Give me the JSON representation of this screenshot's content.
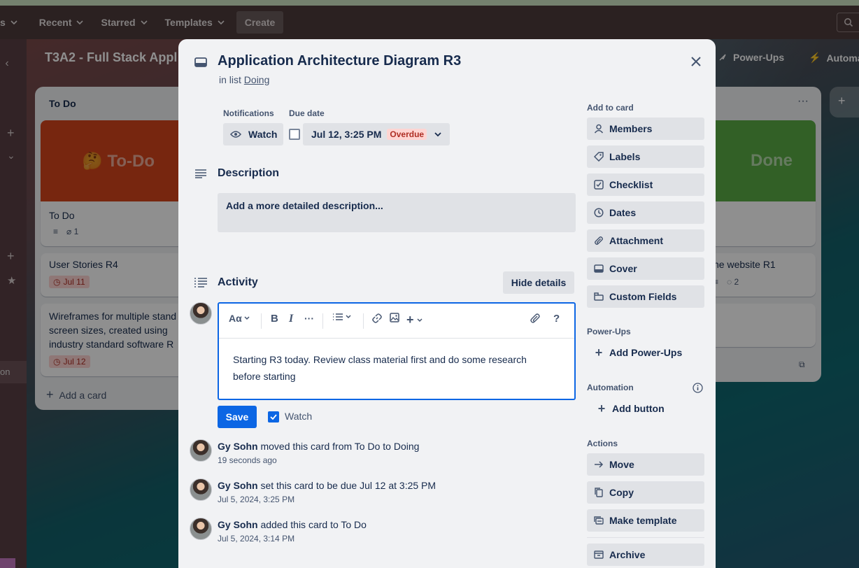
{
  "nav": {
    "partial_left": "s",
    "recent": "Recent",
    "starred": "Starred",
    "templates": "Templates",
    "create": "Create"
  },
  "board": {
    "title": "T3A2 - Full Stack Appl",
    "power_ups": "Power-Ups",
    "automation": "Automa",
    "rail_selected": "on",
    "lists": {
      "todo": {
        "title": "To Do",
        "cover_text": "🤔 To-Do",
        "cards": [
          {
            "title": "To Do",
            "attachments": "1"
          },
          {
            "title": "User Stories R4",
            "due": "Jul 11"
          },
          {
            "title": "Wireframes for multiple stand screen sizes, created using industry standard software R",
            "due": "Jul 12"
          }
        ],
        "add_card": "Add a card"
      },
      "done": {
        "cover_text": "Done",
        "card_title": "he website R1",
        "comments": "2"
      }
    }
  },
  "modal": {
    "title": "Application Architecture Diagram R3",
    "in_list_prefix": "in list",
    "list_name": "Doing",
    "notifications_label": "Notifications",
    "watch_label": "Watch",
    "due_date_label": "Due date",
    "due_date_value": "Jul 12, 3:25 PM",
    "overdue_label": "Overdue",
    "description_title": "Description",
    "description_placeholder": "Add a more detailed description...",
    "activity_title": "Activity",
    "hide_details": "Hide details",
    "editor": {
      "text_style": "Aα",
      "comment_text": "Starting R3 today. Review class material first and do some research before starting"
    },
    "save_label": "Save",
    "watch_checkbox_label": "Watch",
    "activity": [
      {
        "user": "Gy Sohn",
        "action": "moved this card from To Do to Doing",
        "time": "19 seconds ago"
      },
      {
        "user": "Gy Sohn",
        "action": "set this card to be due Jul 12 at 3:25 PM",
        "time": "Jul 5, 2024, 3:25 PM"
      },
      {
        "user": "Gy Sohn",
        "action": "added this card to To Do",
        "time": "Jul 5, 2024, 3:14 PM"
      }
    ],
    "sidebar": {
      "add_to_card": "Add to card",
      "members": "Members",
      "labels": "Labels",
      "checklist": "Checklist",
      "dates": "Dates",
      "attachment": "Attachment",
      "cover": "Cover",
      "custom_fields": "Custom Fields",
      "power_ups_head": "Power-Ups",
      "add_power_ups": "Add Power-Ups",
      "automation_head": "Automation",
      "add_button": "Add button",
      "actions_head": "Actions",
      "move": "Move",
      "copy": "Copy",
      "make_template": "Make template",
      "archive": "Archive"
    }
  },
  "colors": {
    "primary": "#0c66e4",
    "overdue_bg": "#ffd5d2",
    "overdue_text": "#ae2e24",
    "todo_cover": "#d4451c",
    "done_cover": "#5aac44"
  }
}
